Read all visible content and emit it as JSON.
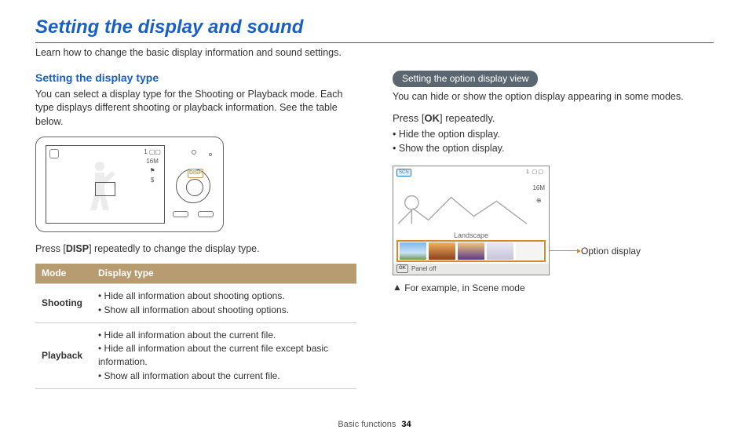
{
  "page": {
    "title": "Setting the display and sound",
    "intro": "Learn how to change the basic display information and sound settings."
  },
  "left": {
    "subhead": "Setting the display type",
    "para": "You can select a display type for the Shooting or Playback mode. Each type displays different shooting or playback information. See the table below.",
    "camera": {
      "disp_label": "DISP",
      "screen_side_icons": [
        "1 ▢▢",
        "16M",
        "⚑",
        "$"
      ]
    },
    "press_line_before": "Press [",
    "press_token": "DISP",
    "press_line_after": "] repeatedly to change the display type.",
    "table": {
      "headers": {
        "mode": "Mode",
        "type": "Display type"
      },
      "rows": [
        {
          "mode": "Shooting",
          "items": [
            "Hide all information about shooting options.",
            "Show all information about shooting options."
          ]
        },
        {
          "mode": "Playback",
          "items": [
            "Hide all information about the current file.",
            "Hide all information about the current file except basic information.",
            "Show all information about the current file."
          ]
        }
      ]
    }
  },
  "right": {
    "pill": "Setting the option display view",
    "para": "You can hide or show the option display appearing in some modes.",
    "press_before": "Press [",
    "press_token": "OK",
    "press_after": "] repeatedly.",
    "bullets": [
      "Hide the option display.",
      "Show the option display."
    ],
    "illus": {
      "scn_badge": "SCN",
      "top_right": "1 ▢▢",
      "side_icons": [
        "16M",
        "⊕"
      ],
      "label": "Landscape",
      "ok_label": "OK",
      "panel_off": "Panel off",
      "callout": "Option display"
    },
    "example_note": "For example, in Scene mode"
  },
  "footer": {
    "section": "Basic functions",
    "page_number": "34"
  }
}
